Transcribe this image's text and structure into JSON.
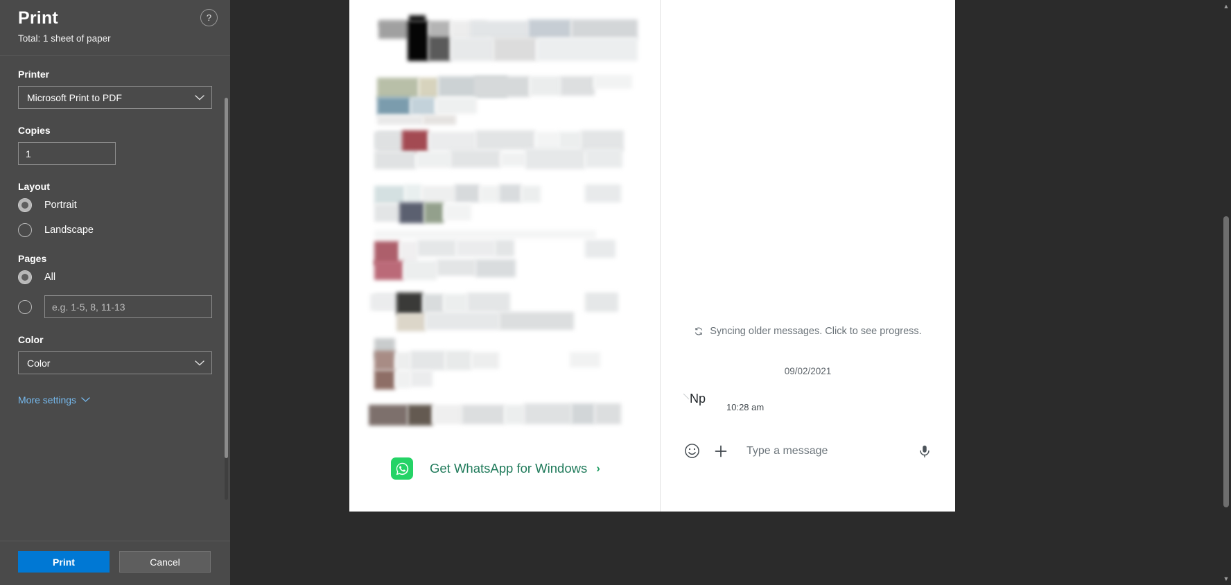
{
  "print_dialog": {
    "title": "Print",
    "subtitle": "Total: 1 sheet of paper",
    "help_label": "?",
    "printer": {
      "label": "Printer",
      "selected": "Microsoft Print to PDF"
    },
    "copies": {
      "label": "Copies",
      "value": "1"
    },
    "layout": {
      "label": "Layout",
      "options": [
        {
          "label": "Portrait",
          "selected": true
        },
        {
          "label": "Landscape",
          "selected": false
        }
      ]
    },
    "pages": {
      "label": "Pages",
      "all_label": "All",
      "all_selected": true,
      "range_selected": false,
      "range_value": "",
      "range_placeholder": "e.g. 1-5, 8, 11-13"
    },
    "color": {
      "label": "Color",
      "selected": "Color"
    },
    "more_settings_label": "More settings",
    "buttons": {
      "print": "Print",
      "cancel": "Cancel"
    },
    "colors": {
      "panel_bg": "#4a4a4a",
      "accent": "#0078d4",
      "link": "#76b9ed",
      "cancel_bg": "#5e5e5e"
    }
  },
  "preview": {
    "whatsapp_banner": {
      "text": "Get WhatsApp for Windows",
      "arrow": "›",
      "icon_color": "#25d366",
      "text_color": "#1f7a5a"
    },
    "chat": {
      "sync_status": "Syncing older messages. Click to see progress.",
      "date_divider": "09/02/2021",
      "message_text": "Np",
      "message_time": "10:28 am",
      "compose_placeholder": "Type a message"
    }
  }
}
